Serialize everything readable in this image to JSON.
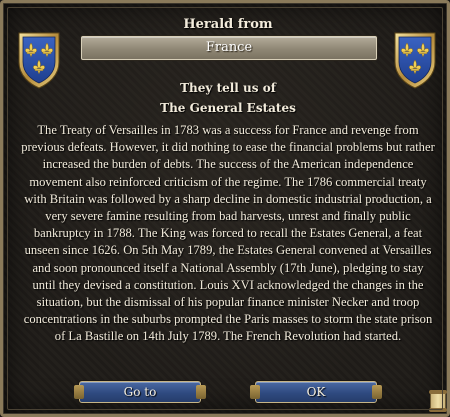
{
  "dialog": {
    "herald_title": "Herald from",
    "country": "France",
    "lead": "They tell us of",
    "event_title": "The General Estates",
    "body": "The Treaty of Versailles in 1783 was a success for France and revenge from previous defeats. However, it did nothing to ease the financial problems but rather increased the burden of debts. The success of the American independence movement also reinforced criticism of the regime. The 1786 commercial treaty with Britain was followed by a sharp decline in domestic industrial production, a very severe famine resulting from bad harvests, unrest and finally public bankruptcy in 1788. The King was forced to recall the Estates General, a feat unseen since 1626. On 5th May 1789, the Estates General convened at Versailles and soon pronounced itself a National Assembly (17th June), pledging to stay until they devised a constitution. Louis XVI acknowledged the changes in the situation, but the dismissal of his popular finance minister Necker and troop concentrations in the suburbs prompted the Paris masses to storm the state prison of La Bastille on 14th July 1789. The French Revolution had started."
  },
  "buttons": {
    "goto_label": "Go to",
    "ok_label": "OK"
  },
  "icons": {
    "left_shield": "france-coat-of-arms-icon",
    "right_shield": "france-coat-of-arms-icon",
    "corner": "scroll-icon"
  },
  "colors": {
    "shield_blue": "#2a4fa8",
    "fleur_gold": "#e8c64a",
    "button_blue": "#2f4a80",
    "text": "#f3ecdc"
  }
}
